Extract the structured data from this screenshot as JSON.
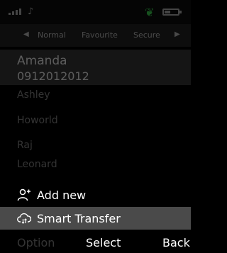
{
  "status_bar": {
    "signal_icon": "signal-bars-icon",
    "music_icon": "music-note-icon",
    "leaf_icon": "leaf-icon",
    "battery_icon": "battery-icon"
  },
  "tabs": {
    "items": [
      "Normal",
      "Favourite",
      "Secure"
    ],
    "selected": "Normal"
  },
  "contacts": {
    "selected": {
      "name": "Amanda",
      "number": "0912012012"
    },
    "items": [
      "Ashley",
      "Howorld",
      "Raj",
      "Leonard"
    ]
  },
  "menu": {
    "items": [
      {
        "label": "Add new",
        "icon": "add-user-icon"
      },
      {
        "label": "Smart Transfer",
        "icon": "cloud-transfer-icon"
      }
    ],
    "highlighted_index": 1
  },
  "softkeys": {
    "left": "Option",
    "center": "Select",
    "right": "Back"
  }
}
